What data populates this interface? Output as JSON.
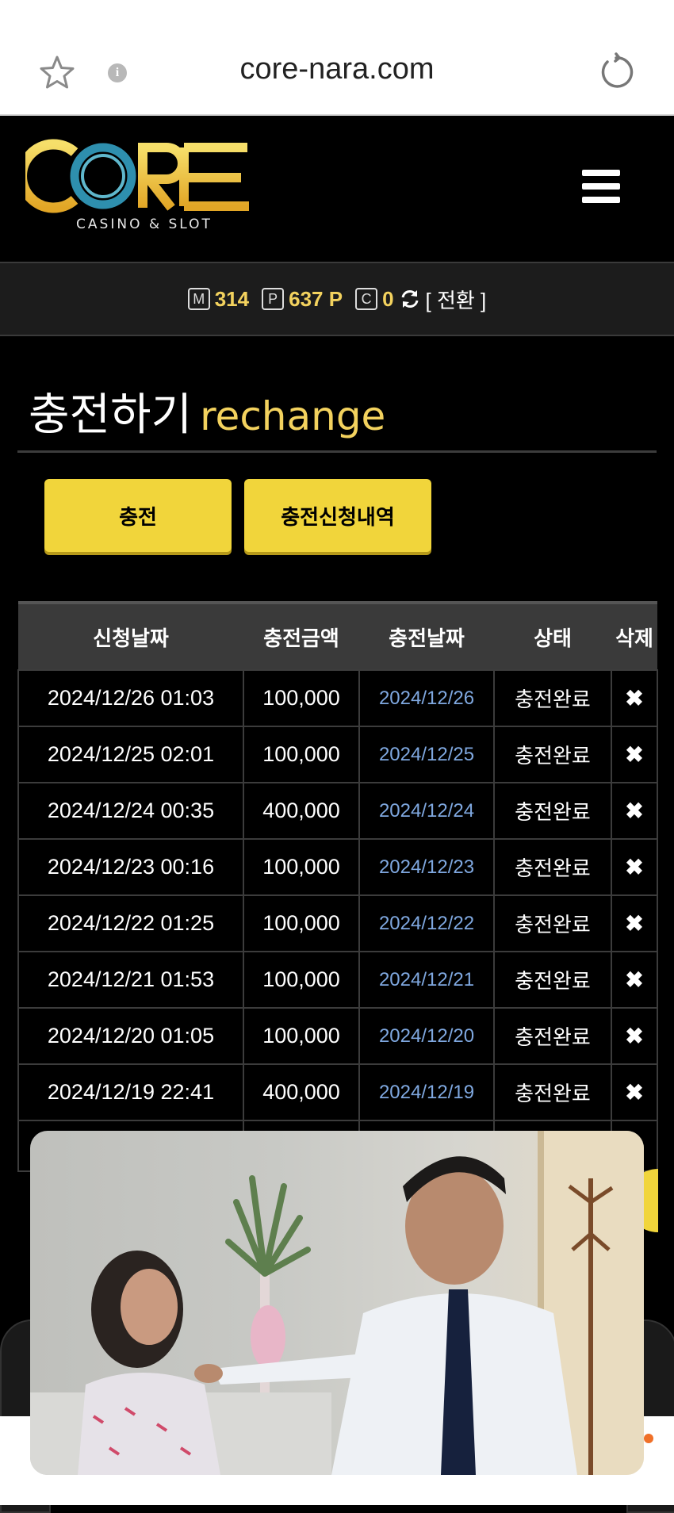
{
  "browser": {
    "url": "core-nara.com"
  },
  "logo": {
    "brand": "CORE",
    "tagline": "CASINO & SLOT"
  },
  "balance": {
    "money_icon": "M",
    "money": "314",
    "point_icon": "P",
    "point": "637 P",
    "coin_icon": "C",
    "coin": "0",
    "switch_label": "[ 전환 ]"
  },
  "title": {
    "main": "충전하기",
    "sub": "rechange"
  },
  "buttons": {
    "charge": "충전",
    "history": "충전신청내역"
  },
  "table": {
    "headers": [
      "신청날짜",
      "충전금액",
      "충전날짜",
      "상태",
      "삭제"
    ],
    "rows": [
      {
        "requested": "2024/12/26 01:03",
        "amount": "100,000",
        "charged": "2024/12/26",
        "status": "충전완료",
        "delete": "✖"
      },
      {
        "requested": "2024/12/25 02:01",
        "amount": "100,000",
        "charged": "2024/12/25",
        "status": "충전완료",
        "delete": "✖"
      },
      {
        "requested": "2024/12/24 00:35",
        "amount": "400,000",
        "charged": "2024/12/24",
        "status": "충전완료",
        "delete": "✖"
      },
      {
        "requested": "2024/12/23 00:16",
        "amount": "100,000",
        "charged": "2024/12/23",
        "status": "충전완료",
        "delete": "✖"
      },
      {
        "requested": "2024/12/22 01:25",
        "amount": "100,000",
        "charged": "2024/12/22",
        "status": "충전완료",
        "delete": "✖"
      },
      {
        "requested": "2024/12/21 01:53",
        "amount": "100,000",
        "charged": "2024/12/21",
        "status": "충전완료",
        "delete": "✖"
      },
      {
        "requested": "2024/12/20 01:05",
        "amount": "100,000",
        "charged": "2024/12/20",
        "status": "충전완료",
        "delete": "✖"
      },
      {
        "requested": "2024/12/19 22:41",
        "amount": "400,000",
        "charged": "2024/12/19",
        "status": "충전완료",
        "delete": "✖"
      }
    ]
  },
  "colors": {
    "accent": "#f1d53b",
    "date_link": "#7fa8e0",
    "background": "#000000"
  }
}
